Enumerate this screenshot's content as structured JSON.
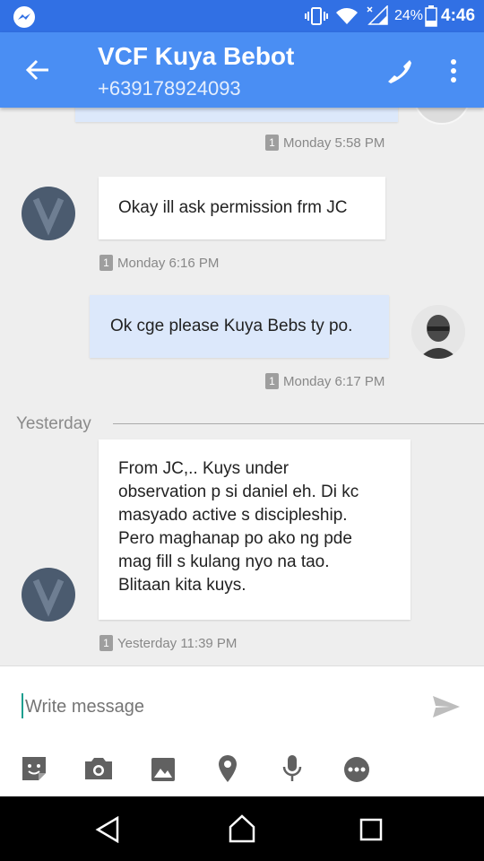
{
  "status_bar": {
    "battery": "24%",
    "time": "4:46",
    "icons": [
      "messenger-icon",
      "vibrate-icon",
      "wifi-icon",
      "signal-icon",
      "battery-icon"
    ]
  },
  "header": {
    "title": "VCF Kuya Bebot",
    "subtitle": "+639178924093",
    "icons": [
      "back-arrow-icon",
      "phone-icon",
      "more-vert-icon"
    ]
  },
  "messages": [
    {
      "direction": "out",
      "text": "",
      "meta": "Monday 5:58 PM",
      "badge": "1"
    },
    {
      "direction": "in",
      "text": "Okay ill ask permission frm JC",
      "meta": "Monday 6:16 PM",
      "badge": "1"
    },
    {
      "direction": "out",
      "text": "Ok cge please Kuya Bebs ty po.",
      "meta": "Monday 6:17 PM",
      "badge": "1"
    },
    {
      "direction": "in",
      "text_lines": [
        "From JC,.. Kuys under",
        "observation p si daniel eh. Di kc",
        "masyado active s discipleship.",
        "Pero maghanap po ako ng pde",
        "mag fill s kulang nyo na tao.",
        "Blitaan kita kuys."
      ],
      "meta": "Yesterday 11:39 PM",
      "badge": "1"
    }
  ],
  "divider": {
    "label": "Yesterday"
  },
  "composer": {
    "placeholder": "Write message",
    "icons": [
      "sticker-icon",
      "camera-icon",
      "image-icon",
      "location-icon",
      "microphone-icon",
      "more-options-icon",
      "send-icon"
    ]
  },
  "nav_bar": {
    "icons": [
      "back-triangle-icon",
      "home-icon",
      "recents-icon"
    ]
  },
  "colors": {
    "status_bar": "#3170e4",
    "app_bar": "#4a8ef3",
    "outgoing_bubble": "#dce8fb",
    "incoming_bubble": "#ffffff",
    "background": "#eeeeee"
  }
}
